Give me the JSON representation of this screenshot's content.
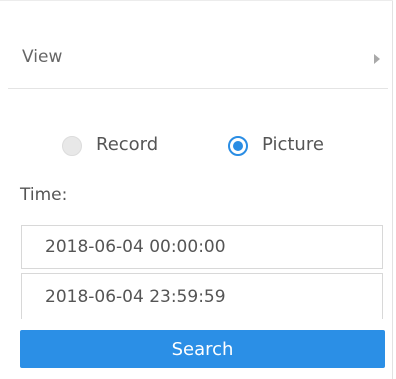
{
  "view": {
    "label": "View",
    "expand_icon": "caret-right-icon"
  },
  "mode": {
    "options": [
      {
        "label": "Record",
        "selected": false
      },
      {
        "label": "Picture",
        "selected": true
      }
    ],
    "accent_color": "#2a8de4"
  },
  "time": {
    "label": "Time:",
    "start": "2018-06-04 00:00:00",
    "end": "2018-06-04 23:59:59"
  },
  "search": {
    "label": "Search",
    "color": "#2b8fe6"
  }
}
